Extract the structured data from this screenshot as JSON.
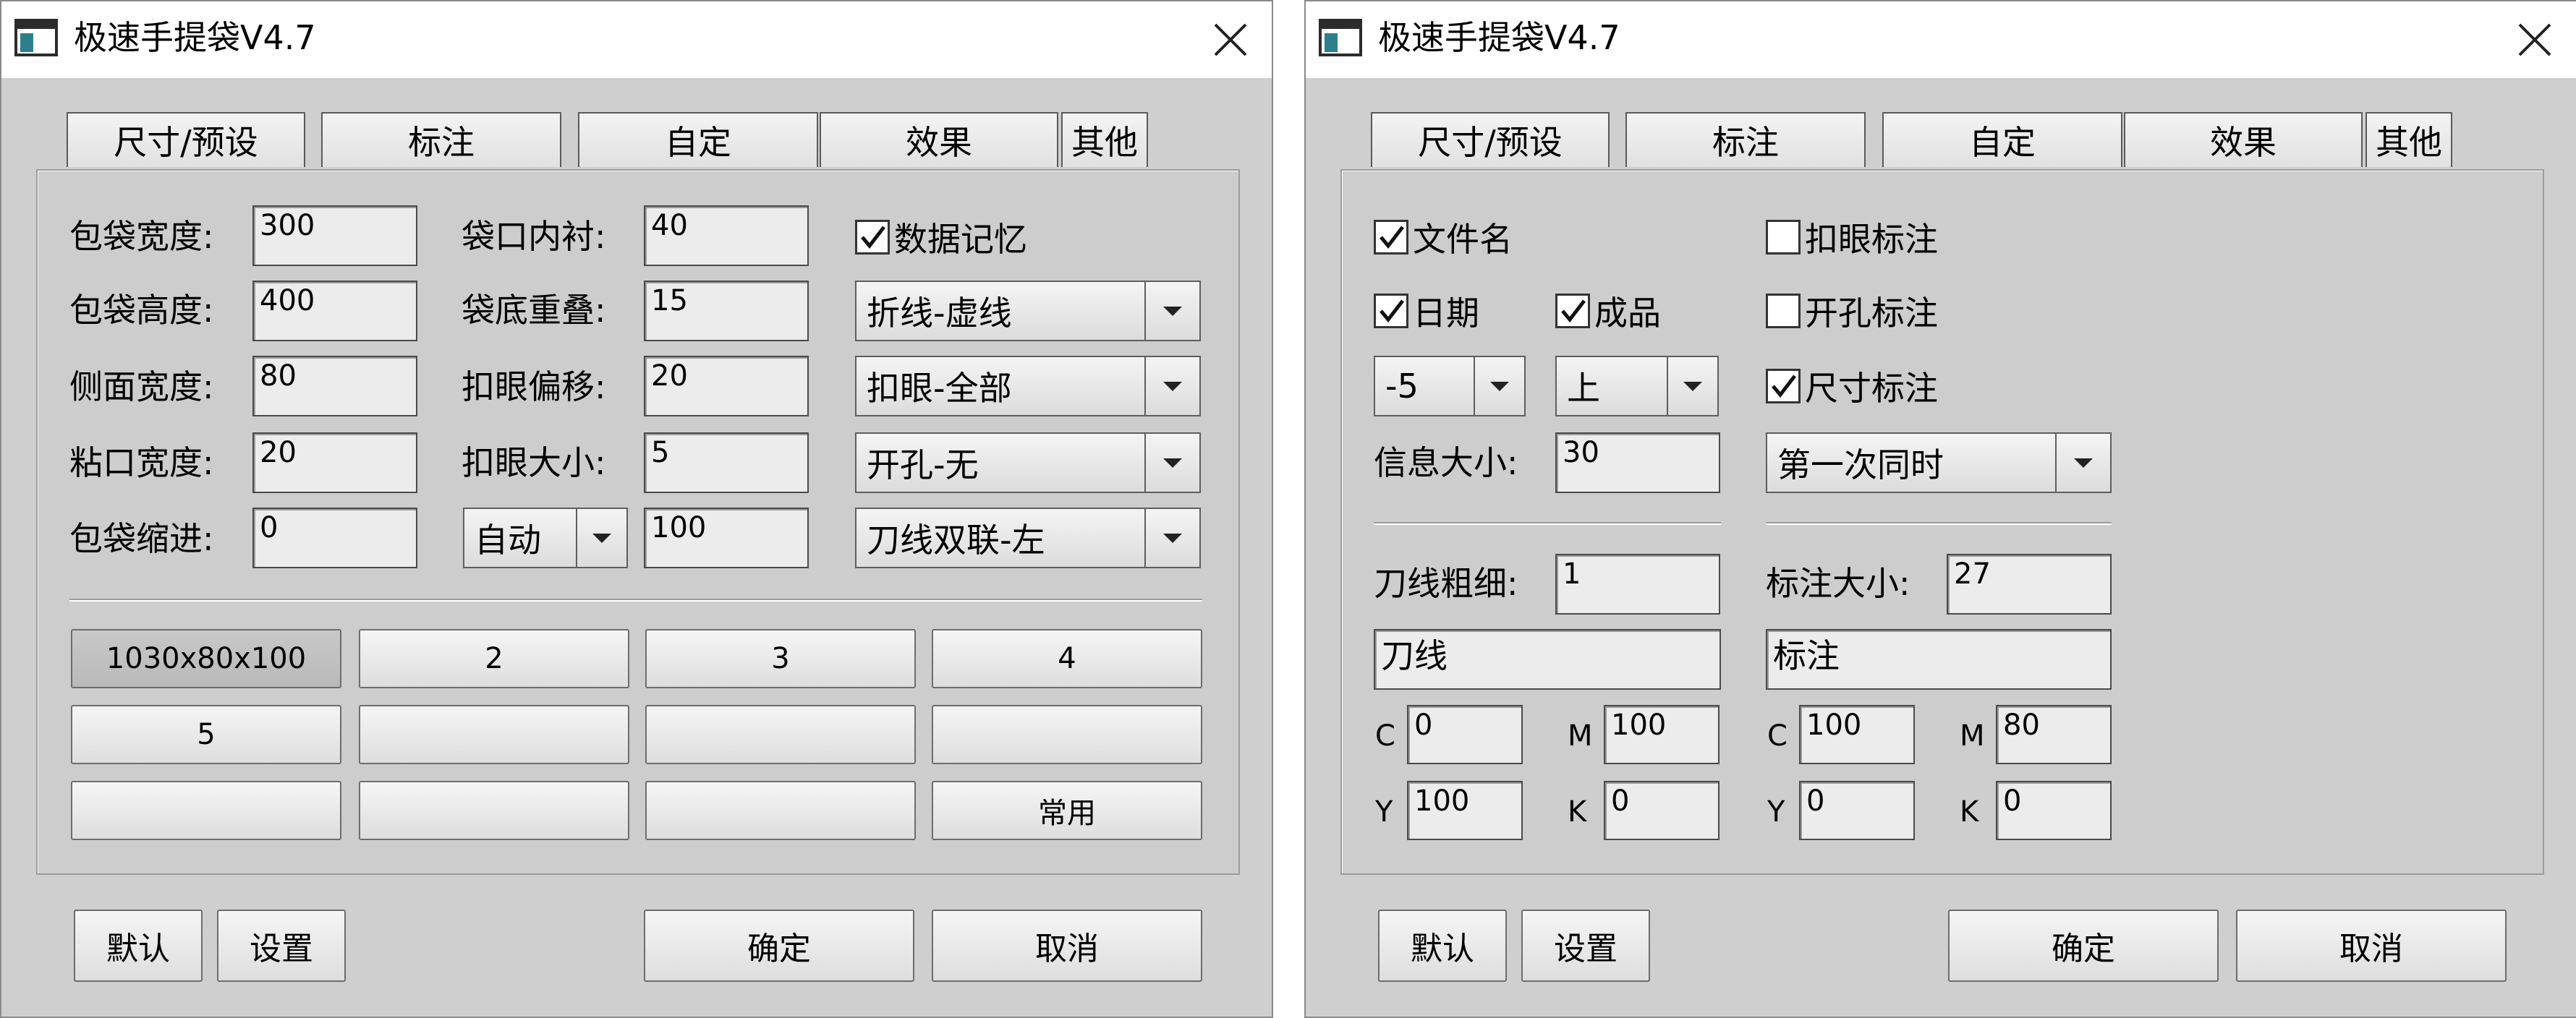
{
  "left": {
    "title": "极速手提袋V4.7",
    "tabs": [
      "尺寸/预设",
      "标注",
      "自定",
      "效果",
      "其他"
    ],
    "fields": {
      "width_label": "包袋宽度:",
      "width_value": "300",
      "height_label": "包袋高度:",
      "height_value": "400",
      "side_label": "侧面宽度:",
      "side_value": "80",
      "glue_label": "粘口宽度:",
      "glue_value": "20",
      "indent_label": "包袋缩进:",
      "indent_value": "0",
      "lining_label": "袋口内衬:",
      "lining_value": "40",
      "overlap_label": "袋底重叠:",
      "overlap_value": "15",
      "eyelet_offset_label": "扣眼偏移:",
      "eyelet_offset_value": "20",
      "eyelet_size_label": "扣眼大小:",
      "eyelet_size_value": "5",
      "auto_select": "自动",
      "auto_value": "100"
    },
    "memory_checkbox": "数据记忆",
    "selects": [
      "折线-虚线",
      "扣眼-全部",
      "开孔-无",
      "刀线双联-左"
    ],
    "presets": [
      "1030x80x100",
      "2",
      "3",
      "4",
      "5",
      "",
      "",
      "",
      "",
      "",
      "",
      "常用"
    ],
    "footer": {
      "default": "默认",
      "settings": "设置",
      "ok": "确定",
      "cancel": "取消"
    }
  },
  "right": {
    "title": "极速手提袋V4.7",
    "tabs": [
      "尺寸/预设",
      "标注",
      "自定",
      "效果",
      "其他"
    ],
    "checks": {
      "filename": "文件名",
      "date": "日期",
      "product": "成品",
      "eyelet_mark": "扣眼标注",
      "hole_mark": "开孔标注",
      "size_mark": "尺寸标注"
    },
    "date_offset": "-5",
    "position": "上",
    "info_size_label": "信息大小:",
    "info_size_value": "30",
    "timing": "第一次同时",
    "knife_label": "刀线粗细:",
    "knife_value": "1",
    "mark_size_label": "标注大小:",
    "mark_size_value": "27",
    "knife_layer": "刀线",
    "mark_layer": "标注",
    "knife_cmyk": {
      "c": "0",
      "m": "100",
      "y": "100",
      "k": "0"
    },
    "mark_cmyk": {
      "c": "100",
      "m": "80",
      "y": "0",
      "k": "0"
    },
    "cmyk_labels": {
      "c": "C",
      "m": "M",
      "y": "Y",
      "k": "K"
    },
    "footer": {
      "default": "默认",
      "settings": "设置",
      "ok": "确定",
      "cancel": "取消"
    }
  }
}
